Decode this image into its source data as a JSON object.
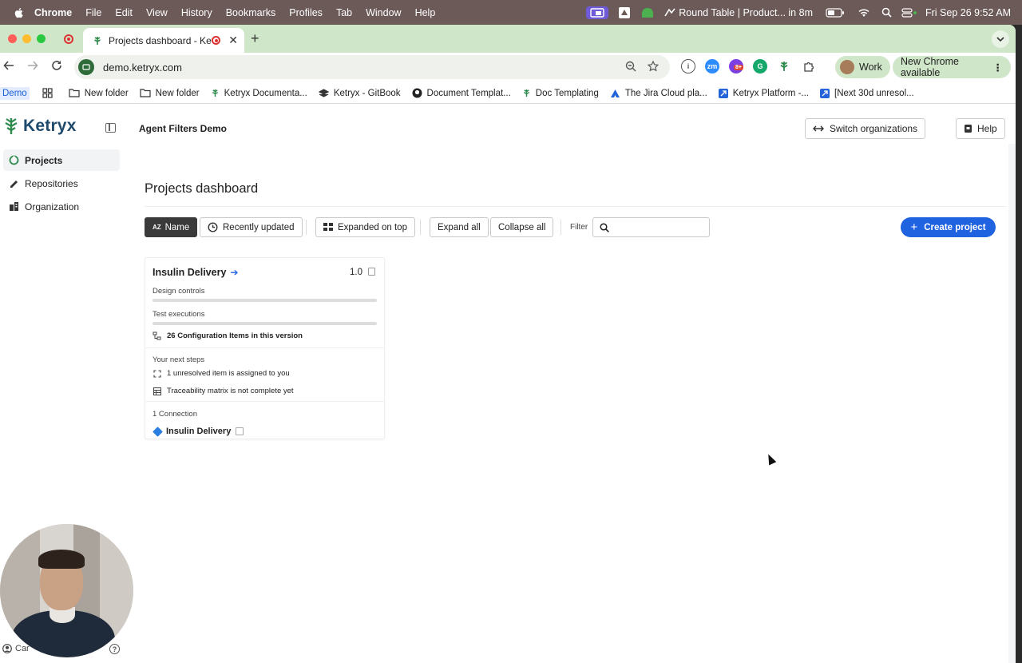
{
  "menubar": {
    "app_name": "Chrome",
    "items": [
      "File",
      "Edit",
      "View",
      "History",
      "Bookmarks",
      "Profiles",
      "Tab",
      "Window",
      "Help"
    ],
    "meeting": "Round Table | Product... in 8m",
    "clock": "Fri Sep 26  9:52 AM"
  },
  "browser": {
    "tab_title": "Projects dashboard - Ketr",
    "url": "demo.ketryx.com",
    "profile": "Work",
    "update_label": "New Chrome available",
    "ext_badge": "8+",
    "bookmarks": [
      "Demo",
      "New folder",
      "New folder",
      "Ketryx Documenta...",
      "Ketryx - GitBook",
      "Document Templat...",
      "Doc Templating",
      "The Jira Cloud pla...",
      "Ketryx Platform -...",
      "[Next 30d unresol..."
    ]
  },
  "app": {
    "logo": "Ketryx",
    "org_name": "Agent Filters Demo",
    "switch_org_label": "Switch organizations",
    "help_label": "Help",
    "nav": [
      {
        "label": "Projects",
        "active": true
      },
      {
        "label": "Repositories",
        "active": false
      },
      {
        "label": "Organization",
        "active": false
      }
    ],
    "page_title": "Projects dashboard",
    "controls": {
      "sort_name": "Name",
      "sort_name_icon_text": "A Z",
      "recently_updated": "Recently updated",
      "expanded_on_top": "Expanded on top",
      "expand_all": "Expand all",
      "collapse_all": "Collapse all",
      "filter_label": "Filter",
      "filter_value": "",
      "create_project": "Create project"
    },
    "project_card": {
      "name": "Insulin Delivery",
      "version": "1.0",
      "design_controls_label": "Design controls",
      "design_controls_progress": 0,
      "test_executions_label": "Test executions",
      "test_executions_progress": 0,
      "config_items": "26 Configuration Items in this version",
      "next_steps_label": "Your next steps",
      "next_steps": [
        "1 unresolved item is assigned to you",
        "Traceability matrix is not complete yet"
      ],
      "connections_label": "1 Connection",
      "connection_name": "Insulin Delivery"
    },
    "bottom_user": "Car"
  },
  "colors": {
    "accent": "#1f63e0",
    "brand": "#1f4a6b",
    "tabbar": "#cfe6c8",
    "menubar": "#6b5a57"
  }
}
